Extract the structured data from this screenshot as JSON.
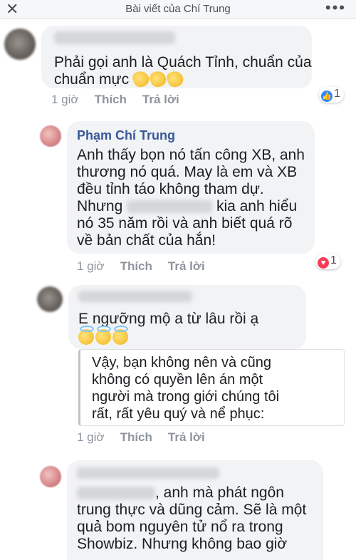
{
  "header": {
    "title": "Bài viết của Chí Trung",
    "close_glyph": "✕",
    "more_glyph": "•••"
  },
  "comments": [
    {
      "author": "",
      "text_lines": [
        "Phải gọi anh là Quách Tỉnh, chuẩn của",
        "chuẩn mực"
      ],
      "emoji": [
        "clapping-hands",
        "clapping-hands",
        "clapping-hands"
      ],
      "time": "1 giờ",
      "like": "Thích",
      "reply": "Trả lời",
      "reaction": {
        "type": "like",
        "count": "1",
        "color": "#2d88ff"
      }
    },
    {
      "author": "Phạm Chí Trung",
      "text_lines": [
        "Anh thấy bọn nó tấn công XB, anh",
        "thương nó quá. May là em và XB",
        "đều tỉnh táo không tham dự."
      ],
      "line4_prefix": "Nhưng",
      "line4_suffix": "kia anh hiểu",
      "text_lines_end": [
        "nó 35 năm rồi và anh biết quá rõ",
        "về bản chất của hắn!"
      ],
      "time": "1 giờ",
      "like": "Thích",
      "reply": "Trả lời",
      "reaction": {
        "type": "love",
        "count": "1",
        "color": "#f33e58"
      }
    },
    {
      "author": "",
      "text_lines": [
        "E ngưỡng mộ a từ lâu rồi ạ"
      ],
      "emoji": [
        "smiling-face-with-halo",
        "smiling-face-with-halo",
        "smiling-face-with-halo"
      ]
    },
    {
      "quote_lines": [
        "Vậy, bạn không nên và cũng",
        "không có quyền lên án một",
        "người mà trong giới chúng tôi",
        "rất, rất yêu quý và nể phục:"
      ],
      "time": "1 giờ",
      "like": "Thích",
      "reply": "Trả lời"
    },
    {
      "author": "",
      "line1_suffix": ", anh mà phát ngôn",
      "text_lines": [
        "trung thực và dũng cảm. Sẽ là một",
        "quả bom nguyên tử nổ ra trong",
        "Showbiz. Nhưng không bao giờ"
      ]
    }
  ]
}
